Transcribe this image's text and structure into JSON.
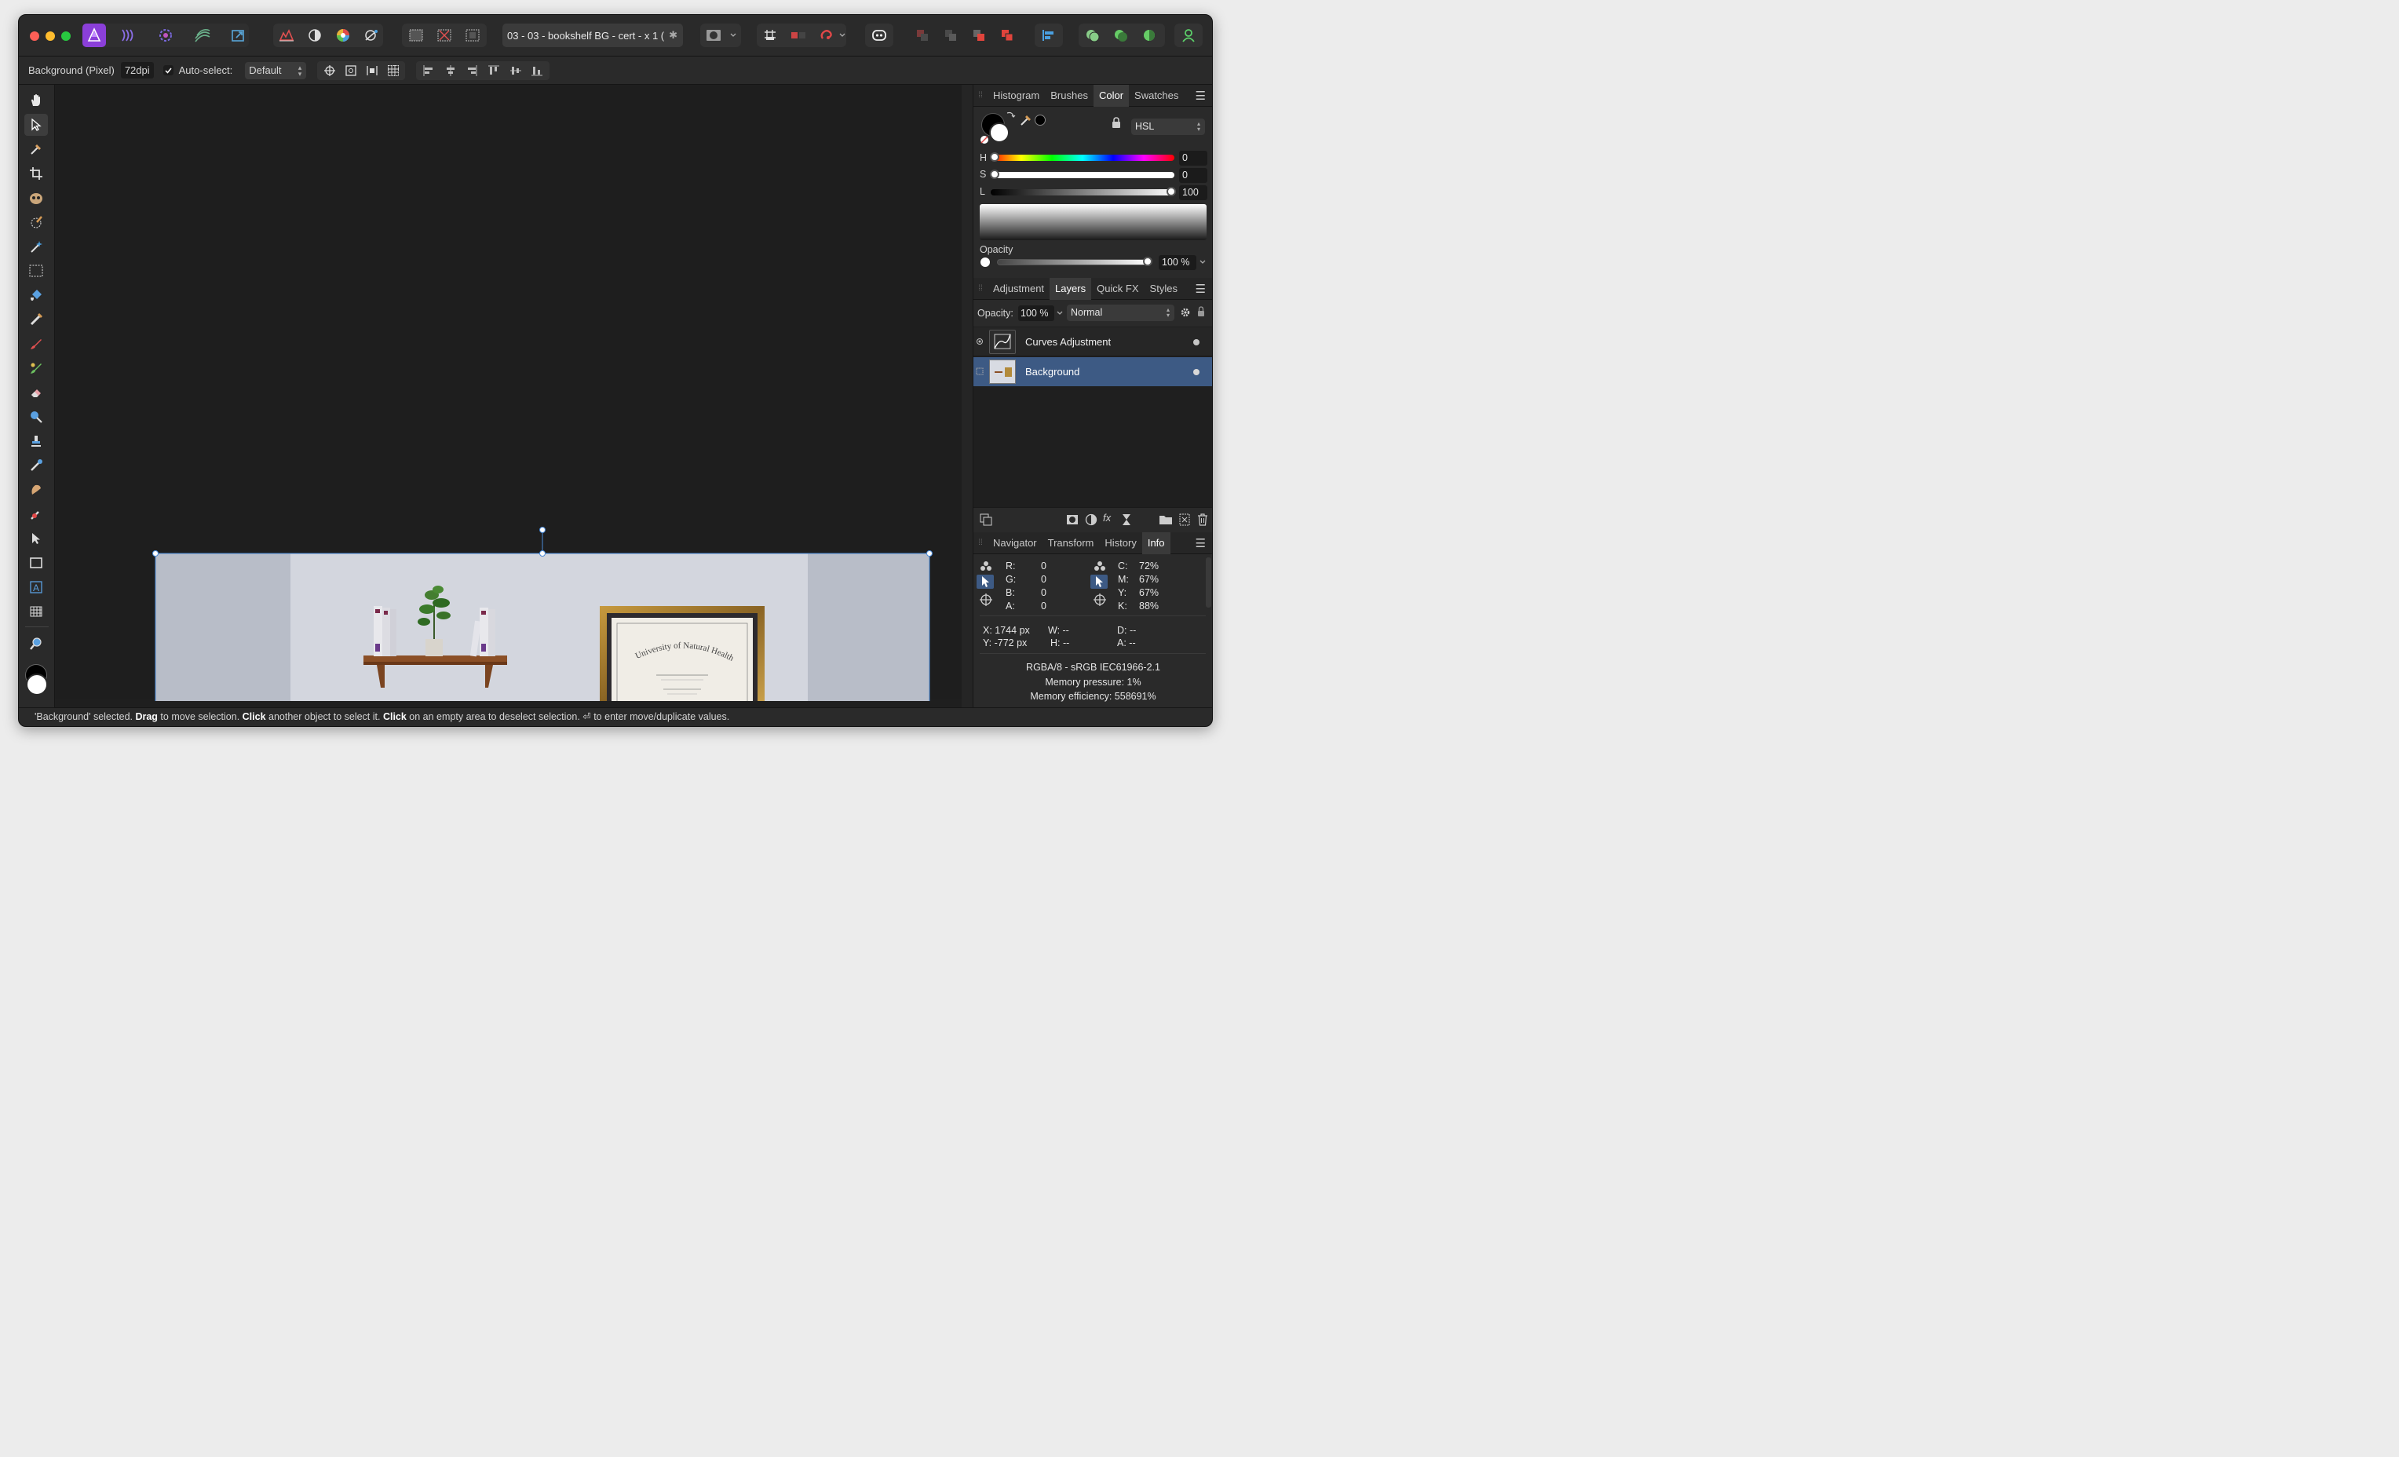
{
  "titlebar": {
    "document_title": "03 - 03 - bookshelf BG - cert - x 1 (",
    "close_doc_glyph": "✱"
  },
  "context": {
    "layer_desc": "Background (Pixel)",
    "dpi": "72dpi",
    "autoselect_label": "Auto-select:",
    "autoselect_value": "Default"
  },
  "color_panel": {
    "tabs": [
      "Histogram",
      "Brushes",
      "Color",
      "Swatches"
    ],
    "active_tab": "Color",
    "model": "HSL",
    "h_label": "H",
    "h_value": "0",
    "s_label": "S",
    "s_value": "0",
    "l_label": "L",
    "l_value": "100",
    "opacity_label": "Opacity",
    "opacity_value": "100 %"
  },
  "layers_panel": {
    "tabs": [
      "Adjustment",
      "Layers",
      "Quick FX",
      "Styles"
    ],
    "active_tab": "Layers",
    "opacity_label": "Opacity:",
    "opacity_value": "100 %",
    "blend_mode": "Normal",
    "layers": [
      {
        "name": "Curves Adjustment",
        "selected": false
      },
      {
        "name": "Background",
        "selected": true
      }
    ]
  },
  "info_panel": {
    "tabs": [
      "Navigator",
      "Transform",
      "History",
      "Info"
    ],
    "active_tab": "Info",
    "rgba": {
      "r_label": "R:",
      "r": "0",
      "g_label": "G:",
      "g": "0",
      "b_label": "B:",
      "b": "0",
      "a_label": "A:",
      "a": "0"
    },
    "cmyk": {
      "c_label": "C:",
      "c": "72%",
      "m_label": "M:",
      "m": "67%",
      "y_label": "Y:",
      "y": "67%",
      "k_label": "K:",
      "k": "88%"
    },
    "x": "X: 1744 px",
    "y": "Y: -772 px",
    "w": "W: --",
    "h": "H: --",
    "d": "D: --",
    "a": "A: --",
    "color_profile": "RGBA/8 - sRGB IEC61966-2.1",
    "memory_pressure": "Memory pressure: 1%",
    "memory_efficiency": "Memory efficiency: 558691%"
  },
  "status": {
    "p1": "'Background' selected. ",
    "b1": "Drag",
    "p2": " to move selection. ",
    "b2": "Click",
    "p3": " another object to select it. ",
    "b3": "Click",
    "p4": " on an empty area to deselect selection. ⏎ to enter move/duplicate values."
  },
  "certificate": {
    "institution": "University of Natural Health"
  },
  "colors": {
    "accent": "#3d5a84",
    "app_icon": "#8b3fd9",
    "red": "#e0443c"
  }
}
